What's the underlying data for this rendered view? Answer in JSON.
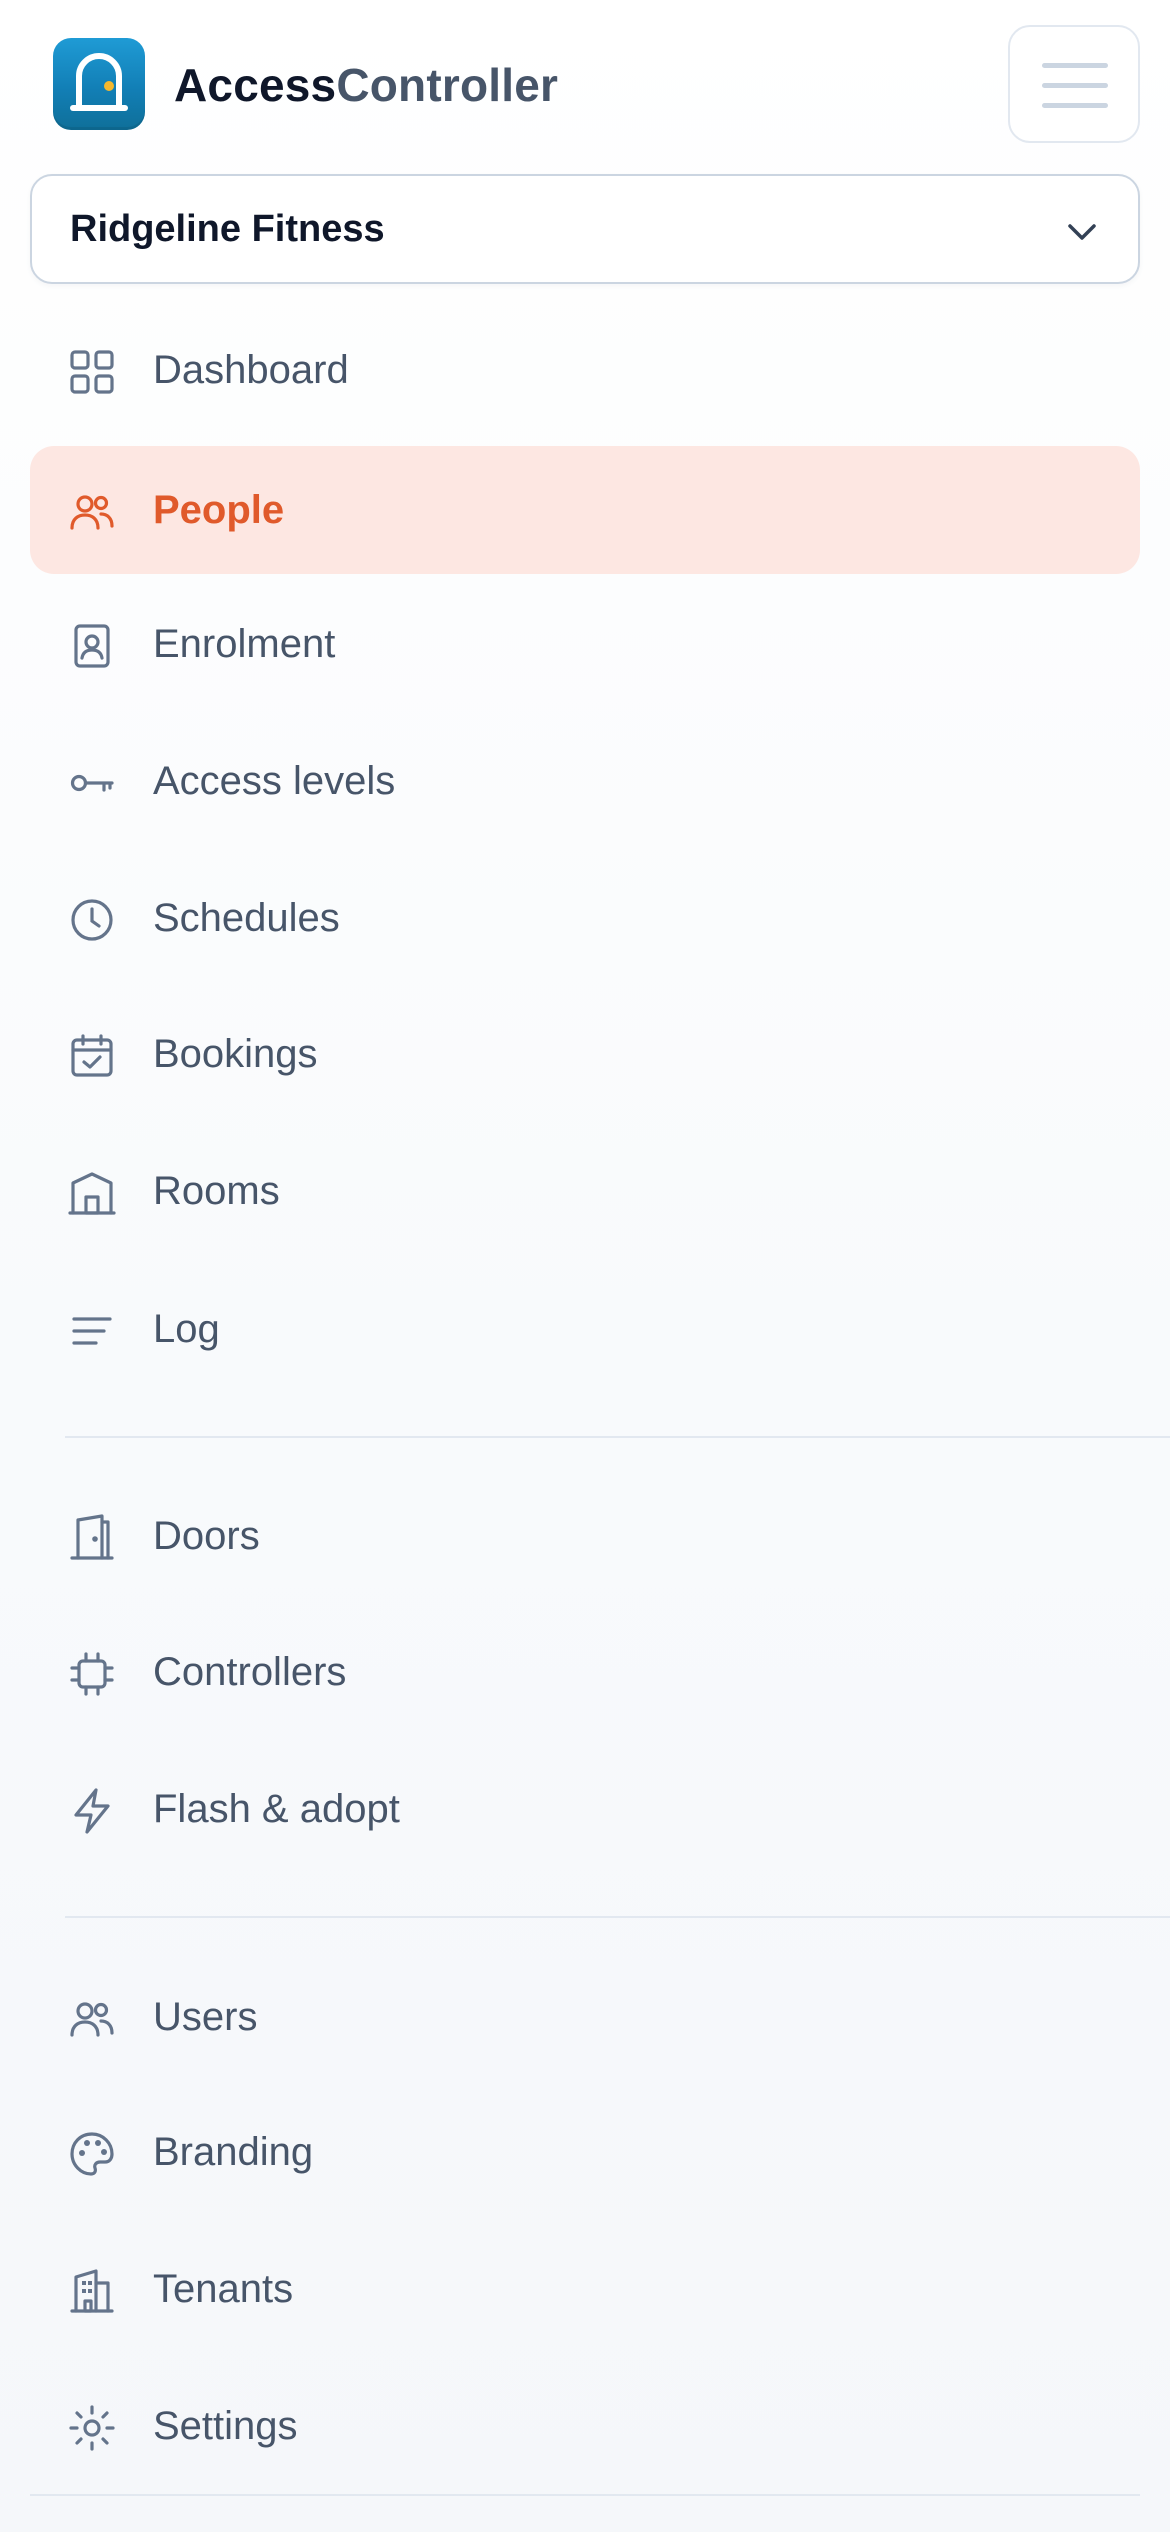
{
  "app": {
    "name_part1": "Access",
    "name_part2": "Controller"
  },
  "tenant_selector": {
    "value": "Ridgeline Fitness"
  },
  "nav": {
    "primary": [
      {
        "label": "Dashboard",
        "icon": "grid-icon"
      },
      {
        "label": "People",
        "icon": "users-icon",
        "active": true
      },
      {
        "label": "Enrolment",
        "icon": "id-badge-icon"
      },
      {
        "label": "Access levels",
        "icon": "key-icon"
      },
      {
        "label": "Schedules",
        "icon": "clock-icon"
      },
      {
        "label": "Bookings",
        "icon": "calendar-check-icon"
      },
      {
        "label": "Rooms",
        "icon": "room-icon"
      },
      {
        "label": "Log",
        "icon": "list-icon"
      }
    ],
    "hardware": [
      {
        "label": "Doors",
        "icon": "door-icon"
      },
      {
        "label": "Controllers",
        "icon": "chip-icon"
      },
      {
        "label": "Flash & adopt",
        "icon": "lightning-icon"
      }
    ],
    "admin": [
      {
        "label": "Users",
        "icon": "users-icon"
      },
      {
        "label": "Branding",
        "icon": "palette-icon"
      },
      {
        "label": "Tenants",
        "icon": "building-icon"
      },
      {
        "label": "Settings",
        "icon": "sun-gear-icon"
      }
    ]
  },
  "colors": {
    "accent": "#e05a2b",
    "active_bg": "#fde7e2",
    "logo_blue": "#1a8cc6",
    "logo_dot": "#f5b82e"
  }
}
